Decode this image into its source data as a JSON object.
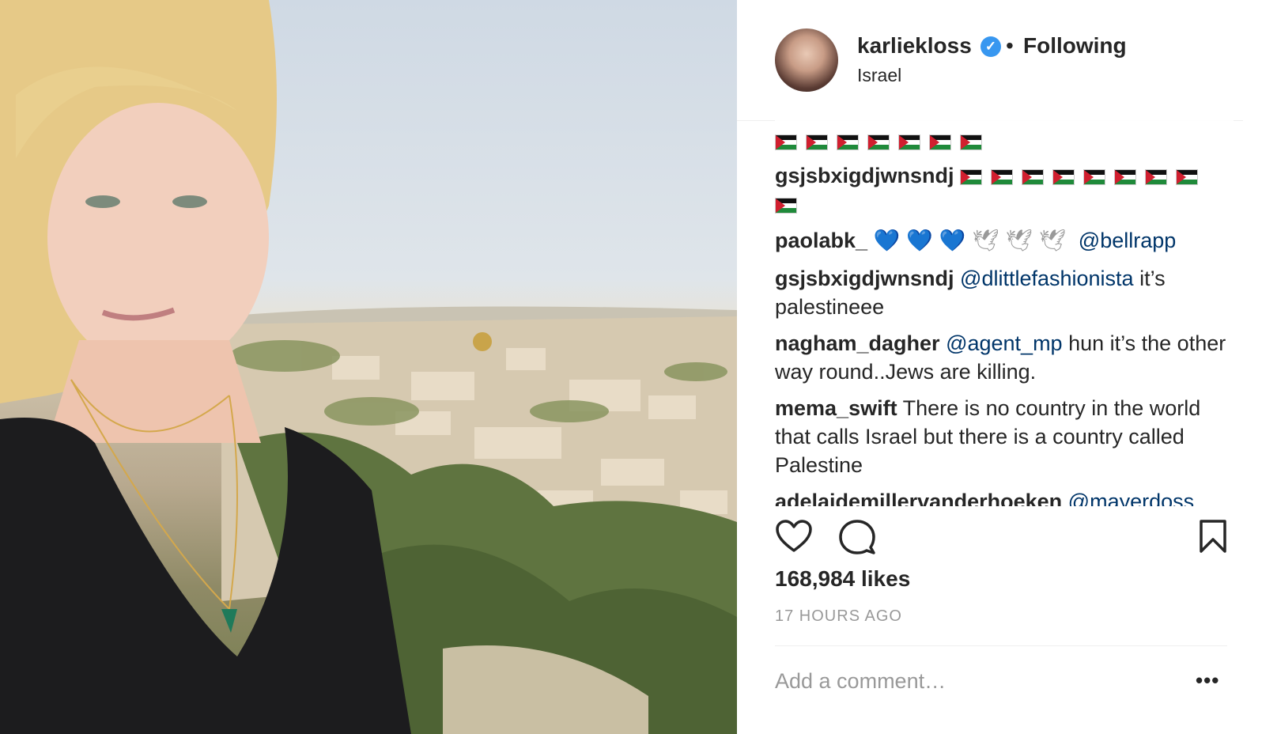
{
  "post": {
    "username": "karliekloss",
    "separator": "•",
    "follow_label": "Following",
    "location": "Israel",
    "verified_icon": "✓"
  },
  "comments": [
    {
      "username": "",
      "partial": true,
      "text": ""
    },
    {
      "username": "gsjsbxigdjwnsndj",
      "text": ""
    },
    {
      "username": "paolabk_",
      "mention": "@bellrapp"
    },
    {
      "username": "gsjsbxigdjwnsndj",
      "mention": "@dlittlefashionista",
      "text_after": " it’s palestineee"
    },
    {
      "username": "nagham_dagher",
      "mention": "@agent_mp",
      "text_after": " hun it’s the other way round..Jews are killing."
    },
    {
      "username": "mema_swift",
      "text": " There is no country in the world that calls Israel but there is a country called Palestine"
    },
    {
      "username": "adelaidemillervanderhoeken",
      "mention": "@mayerdoss",
      "partial": true
    }
  ],
  "emoji": {
    "blue_heart": "💙",
    "dove": "🕊"
  },
  "likes": "168,984 likes",
  "timestamp": "17 HOURS AGO",
  "add_comment_placeholder": "Add a comment…",
  "more_label": "•••",
  "colors": {
    "text": "#262626",
    "mention": "#003569",
    "muted": "#999999",
    "verified": "#3897f0"
  }
}
